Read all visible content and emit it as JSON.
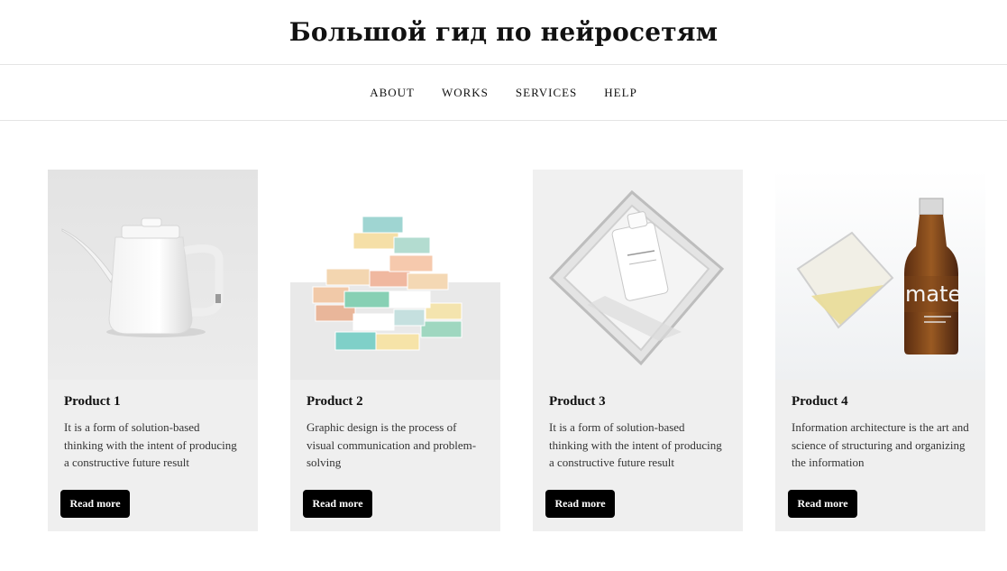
{
  "site": {
    "title": "Большой гид по нейросетям"
  },
  "nav": [
    {
      "label": "ABOUT"
    },
    {
      "label": "WORKS"
    },
    {
      "label": "SERVICES"
    },
    {
      "label": "HELP"
    }
  ],
  "products": [
    {
      "title": "Product 1",
      "text": "It is a form of solution-based thinking with the intent of producing a constructive future result",
      "button": "Read more",
      "image": "white kettle"
    },
    {
      "title": "Product 2",
      "text": "Graphic design is the process of visual communication and problem-solving",
      "button": "Read more",
      "image": "stack of pastel boxes"
    },
    {
      "title": "Product 3",
      "text": "It is a form of solution-based thinking with the intent of producing a constructive future result",
      "button": "Read more",
      "image": "bottle in glass cube"
    },
    {
      "title": "Product 4",
      "text": "Information architecture is the art and science of structuring and organizing the information",
      "button": "Read more",
      "image": "glass and mate bottle"
    }
  ]
}
